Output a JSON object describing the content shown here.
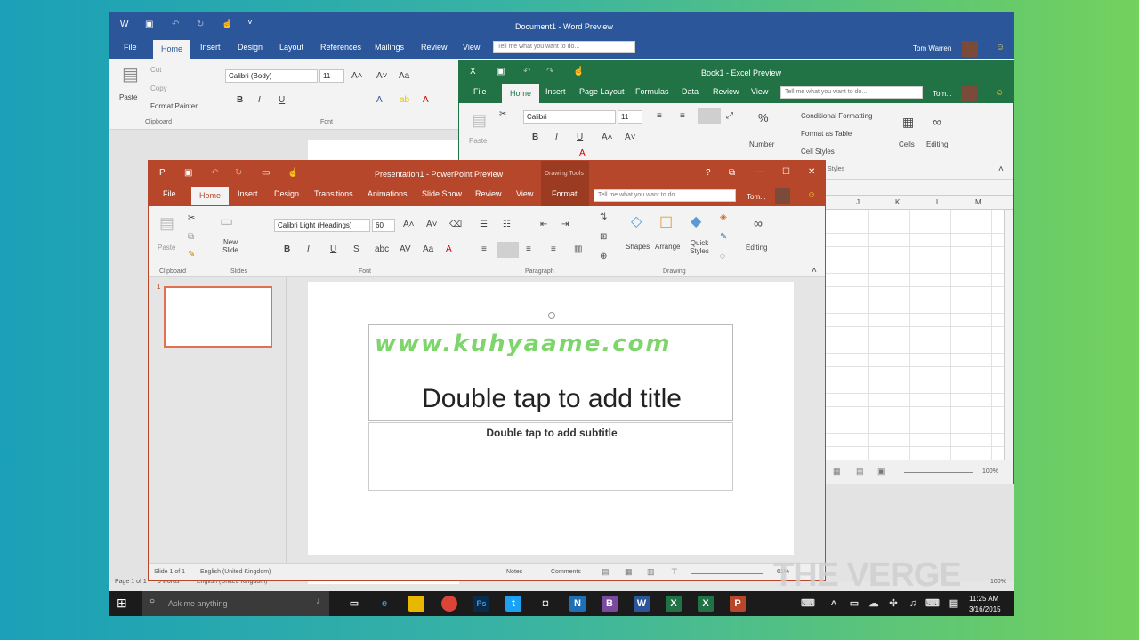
{
  "word": {
    "title": "Document1 - Word Preview",
    "user": "Tom Warren",
    "tabs": [
      "File",
      "Home",
      "Insert",
      "Design",
      "Layout",
      "References",
      "Mailings",
      "Review",
      "View"
    ],
    "tell": "Tell me what you want to do...",
    "clipboard": {
      "paste": "Paste",
      "cut": "Cut",
      "copy": "Copy",
      "painter": "Format Painter",
      "group": "Clipboard"
    },
    "font": {
      "name": "Calibri (Body)",
      "size": "11",
      "group": "Font"
    },
    "status": {
      "page": "Page 1 of 1",
      "words": "0 words",
      "lang": "English (United Kingdom)",
      "zoom": "100%"
    }
  },
  "excel": {
    "title": "Book1 - Excel Preview",
    "user": "Tom...",
    "tabs": [
      "File",
      "Home",
      "Insert",
      "Page Layout",
      "Formulas",
      "Data",
      "Review",
      "View"
    ],
    "tell": "Tell me what you want to do...",
    "font": {
      "name": "Calibri",
      "size": "11"
    },
    "paste": "Paste",
    "number": "Number",
    "cond": "Conditional Formatting",
    "table": "Format as Table",
    "cell": "Cell Styles",
    "styles": "Styles",
    "cells": "Cells",
    "editing": "Editing",
    "cols": [
      "J",
      "K",
      "L",
      "M"
    ],
    "zoom": "100%"
  },
  "ppt": {
    "title": "Presentation1 - PowerPoint Preview",
    "drawing_tools": "Drawing Tools",
    "user": "Tom...",
    "tabs": [
      "File",
      "Home",
      "Insert",
      "Design",
      "Transitions",
      "Animations",
      "Slide Show",
      "Review",
      "View",
      "Format"
    ],
    "tell": "Tell me what you want to do...",
    "font": {
      "name": "Calibri Light (Headings)",
      "size": "60"
    },
    "groups": {
      "clipboard": "Clipboard",
      "slides": "Slides",
      "font": "Font",
      "paragraph": "Paragraph",
      "drawing": "Drawing"
    },
    "paste": "Paste",
    "new_slide": "New Slide",
    "shapes": "Shapes",
    "arrange": "Arrange",
    "quick_styles": "Quick Styles",
    "editing": "Editing",
    "slide_number": "1",
    "slide": {
      "watermark": "www.kuhyaame.com",
      "title": "Double tap to add title",
      "subtitle": "Double tap to add subtitle"
    },
    "status": {
      "slide": "Slide 1 of 1",
      "lang": "English (United Kingdom)",
      "notes": "Notes",
      "comments": "Comments",
      "zoom": "61%"
    }
  },
  "taskbar": {
    "search": "Ask me anything",
    "time": "11:25 AM",
    "date": "3/16/2015"
  },
  "watermark": "THE VERGE"
}
